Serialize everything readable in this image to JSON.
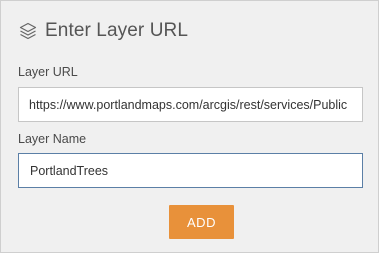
{
  "panel": {
    "title": "Enter Layer URL",
    "title_icon": "layers-icon"
  },
  "form": {
    "url_label": "Layer URL",
    "url_value": "https://www.portlandmaps.com/arcgis/rest/services/Public",
    "name_label": "Layer Name",
    "name_value": "PortlandTrees"
  },
  "actions": {
    "add_label": "ADD"
  },
  "colors": {
    "panel_background": "#f0f0f0",
    "accent_button": "#e8913a",
    "focused_border": "#5b7fa6"
  }
}
